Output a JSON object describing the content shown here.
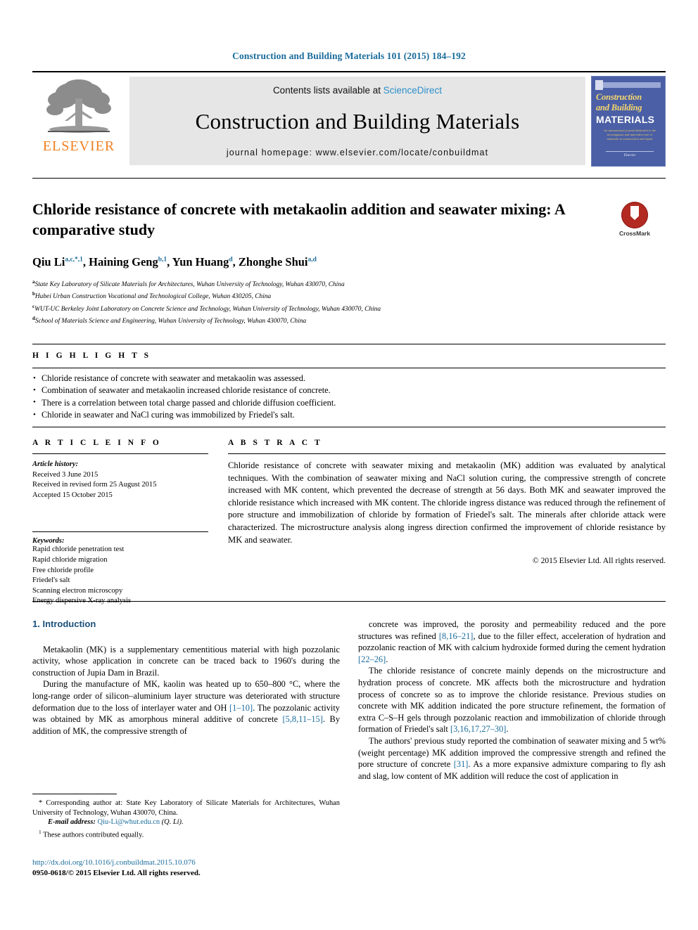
{
  "running_head": "Construction and Building Materials 101 (2015) 184–192",
  "masthead": {
    "publisher_name": "ELSEVIER",
    "contents_prefix": "Contents lists available at ",
    "contents_link": "ScienceDirect",
    "journal_title": "Construction and Building Materials",
    "journal_homepage": "journal homepage: www.elsevier.com/locate/conbuildmat",
    "cover": {
      "line1": "Construction",
      "line2": "and Building",
      "line3": "MATERIALS",
      "blurb": "An international journal dedicated to the investigation and innovative use of materials in construction and repair",
      "footer": "Elsevier"
    }
  },
  "article": {
    "title": "Chloride resistance of concrete with metakaolin addition and seawater mixing: A comparative study",
    "crossmark_label": "CrossMark",
    "authors": [
      {
        "name": "Qiu Li",
        "marks": "a,c,*,1",
        "sep": ", "
      },
      {
        "name": "Haining Geng",
        "marks": "b,1",
        "sep": ", "
      },
      {
        "name": "Yun Huang",
        "marks": "d",
        "sep": ", "
      },
      {
        "name": "Zhonghe Shui",
        "marks": "a,d",
        "sep": ""
      }
    ],
    "affiliations": [
      {
        "mark": "a",
        "text": "State Key Laboratory of Silicate Materials for Architectures, Wuhan University of Technology, Wuhan 430070, China"
      },
      {
        "mark": "b",
        "text": "Hubei Urban Construction Vocational and Technological College, Wuhan 430205, China"
      },
      {
        "mark": "c",
        "text": "WUT-UC Berkeley Joint Laboratory on Concrete Science and Technology, Wuhan University of Technology, Wuhan 430070, China"
      },
      {
        "mark": "d",
        "text": "School of Materials Science and Engineering, Wuhan University of Technology, Wuhan 430070, China"
      }
    ]
  },
  "highlights": {
    "heading": "H I G H L I G H T S",
    "items": [
      "Chloride resistance of concrete with seawater and metakaolin was assessed.",
      "Combination of seawater and metakaolin increased chloride resistance of concrete.",
      "There is a correlation between total charge passed and chloride diffusion coefficient.",
      "Chloride in seawater and NaCl curing was immobilized by Friedel's salt."
    ]
  },
  "article_info": {
    "heading": "A R T I C L E    I N F O",
    "history_label": "Article history:",
    "history": [
      "Received 3 June 2015",
      "Received in revised form 25 August 2015",
      "Accepted 15 October 2015"
    ],
    "keywords_label": "Keywords:",
    "keywords": [
      "Rapid chloride penetration test",
      "Rapid chloride migration",
      "Free chloride profile",
      "Friedel's salt",
      "Scanning electron microscopy",
      "Energy dispersive X-ray analysis"
    ]
  },
  "abstract": {
    "heading": "A B S T R A C T",
    "body": "Chloride resistance of concrete with seawater mixing and metakaolin (MK) addition was evaluated by analytical techniques. With the combination of seawater mixing and NaCl solution curing, the compressive strength of concrete increased with MK content, which prevented the decrease of strength at 56 days. Both MK and seawater improved the chloride resistance which increased with MK content. The chloride ingress distance was reduced through the refinement of pore structure and immobilization of chloride by formation of Friedel's salt. The minerals after chloride attack were characterized. The microstructure analysis along ingress direction confirmed the improvement of chloride resistance by MK and seawater.",
    "copyright": "© 2015 Elsevier Ltd. All rights reserved."
  },
  "body": {
    "section_title": "1. Introduction",
    "left_paragraphs": [
      "Metakaolin (MK) is a supplementary cementitious material with high pozzolanic activity, whose application in concrete can be traced back to 1960's during the construction of Jupia Dam in Brazil.",
      "During the manufacture of MK, kaolin was heated up to 650–800 °C, where the long-range order of silicon–aluminium layer structure was deteriorated with structure deformation due to the loss of interlayer water and OH [1–10]. The pozzolanic activity was obtained by MK as amorphous mineral additive of concrete [5,8,11–15]. By addition of MK, the compressive strength of"
    ],
    "right_paragraphs": [
      "concrete was improved, the porosity and permeability reduced and the pore structures was refined [8,16–21], due to the filler effect, acceleration of hydration and pozzolanic reaction of MK with calcium hydroxide formed during the cement hydration [22–26].",
      "The chloride resistance of concrete mainly depends on the microstructure and hydration process of concrete. MK affects both the microstructure and hydration process of concrete so as to improve the chloride resistance. Previous studies on concrete with MK addition indicated the pore structure refinement, the formation of extra C–S–H gels through pozzolanic reaction and immobilization of chloride through formation of Friedel's salt [3,16,17,27–30].",
      "The authors' previous study reported the combination of seawater mixing and 5 wt% (weight percentage) MK addition improved the compressive strength and refined the pore structure of concrete [31]. As a more expansive admixture comparing to fly ash and slag, low content of MK addition will reduce the cost of application in"
    ]
  },
  "footnotes": {
    "corresponding": "* Corresponding author at: State Key Laboratory of Silicate Materials for Architectures, Wuhan University of Technology, Wuhan 430070, China.",
    "email_label": "E-mail address:",
    "email": "Qiu-Li@whut.edu.cn",
    "email_suffix": "(Q. Li).",
    "equal_contrib": "These authors contributed equally."
  },
  "footer": {
    "doi": "http://dx.doi.org/10.1016/j.conbuildmat.2015.10.076",
    "issn_line": "0950-0618/© 2015 Elsevier Ltd. All rights reserved."
  },
  "colors": {
    "link_blue": "#1a6c9c",
    "sciencedirect_blue": "#2c8fc9",
    "elsevier_orange": "#f08020",
    "cover_blue": "#4a5fa5",
    "crossmark_red": "#b22a22"
  }
}
